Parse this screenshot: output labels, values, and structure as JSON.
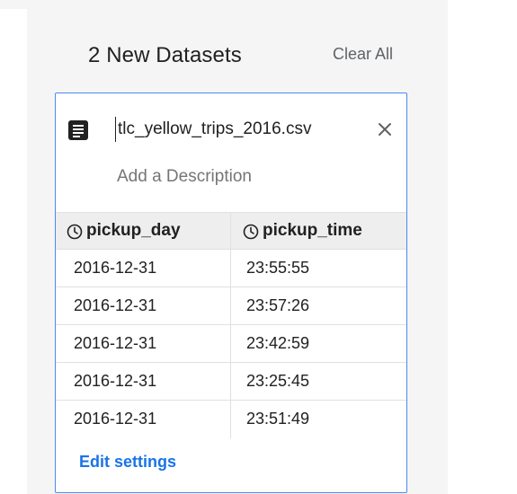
{
  "header": {
    "title": "2 New Datasets",
    "clear_all_label": "Clear All"
  },
  "dataset_card": {
    "icon": "document-icon",
    "file_name": "tlc_yellow_trips_2016.csv",
    "description_placeholder": "Add a Description",
    "columns": [
      {
        "name": "pickup_day",
        "icon": "clock-icon"
      },
      {
        "name": "pickup_time",
        "icon": "clock-icon"
      }
    ],
    "rows": [
      [
        "2016-12-31",
        "23:55:55"
      ],
      [
        "2016-12-31",
        "23:57:26"
      ],
      [
        "2016-12-31",
        "23:42:59"
      ],
      [
        "2016-12-31",
        "23:25:45"
      ],
      [
        "2016-12-31",
        "23:51:49"
      ]
    ],
    "edit_settings_label": "Edit settings"
  },
  "colors": {
    "accent": "#1a73e8",
    "card_border": "#4a8af4",
    "panel_background": "#f5f5f5"
  }
}
